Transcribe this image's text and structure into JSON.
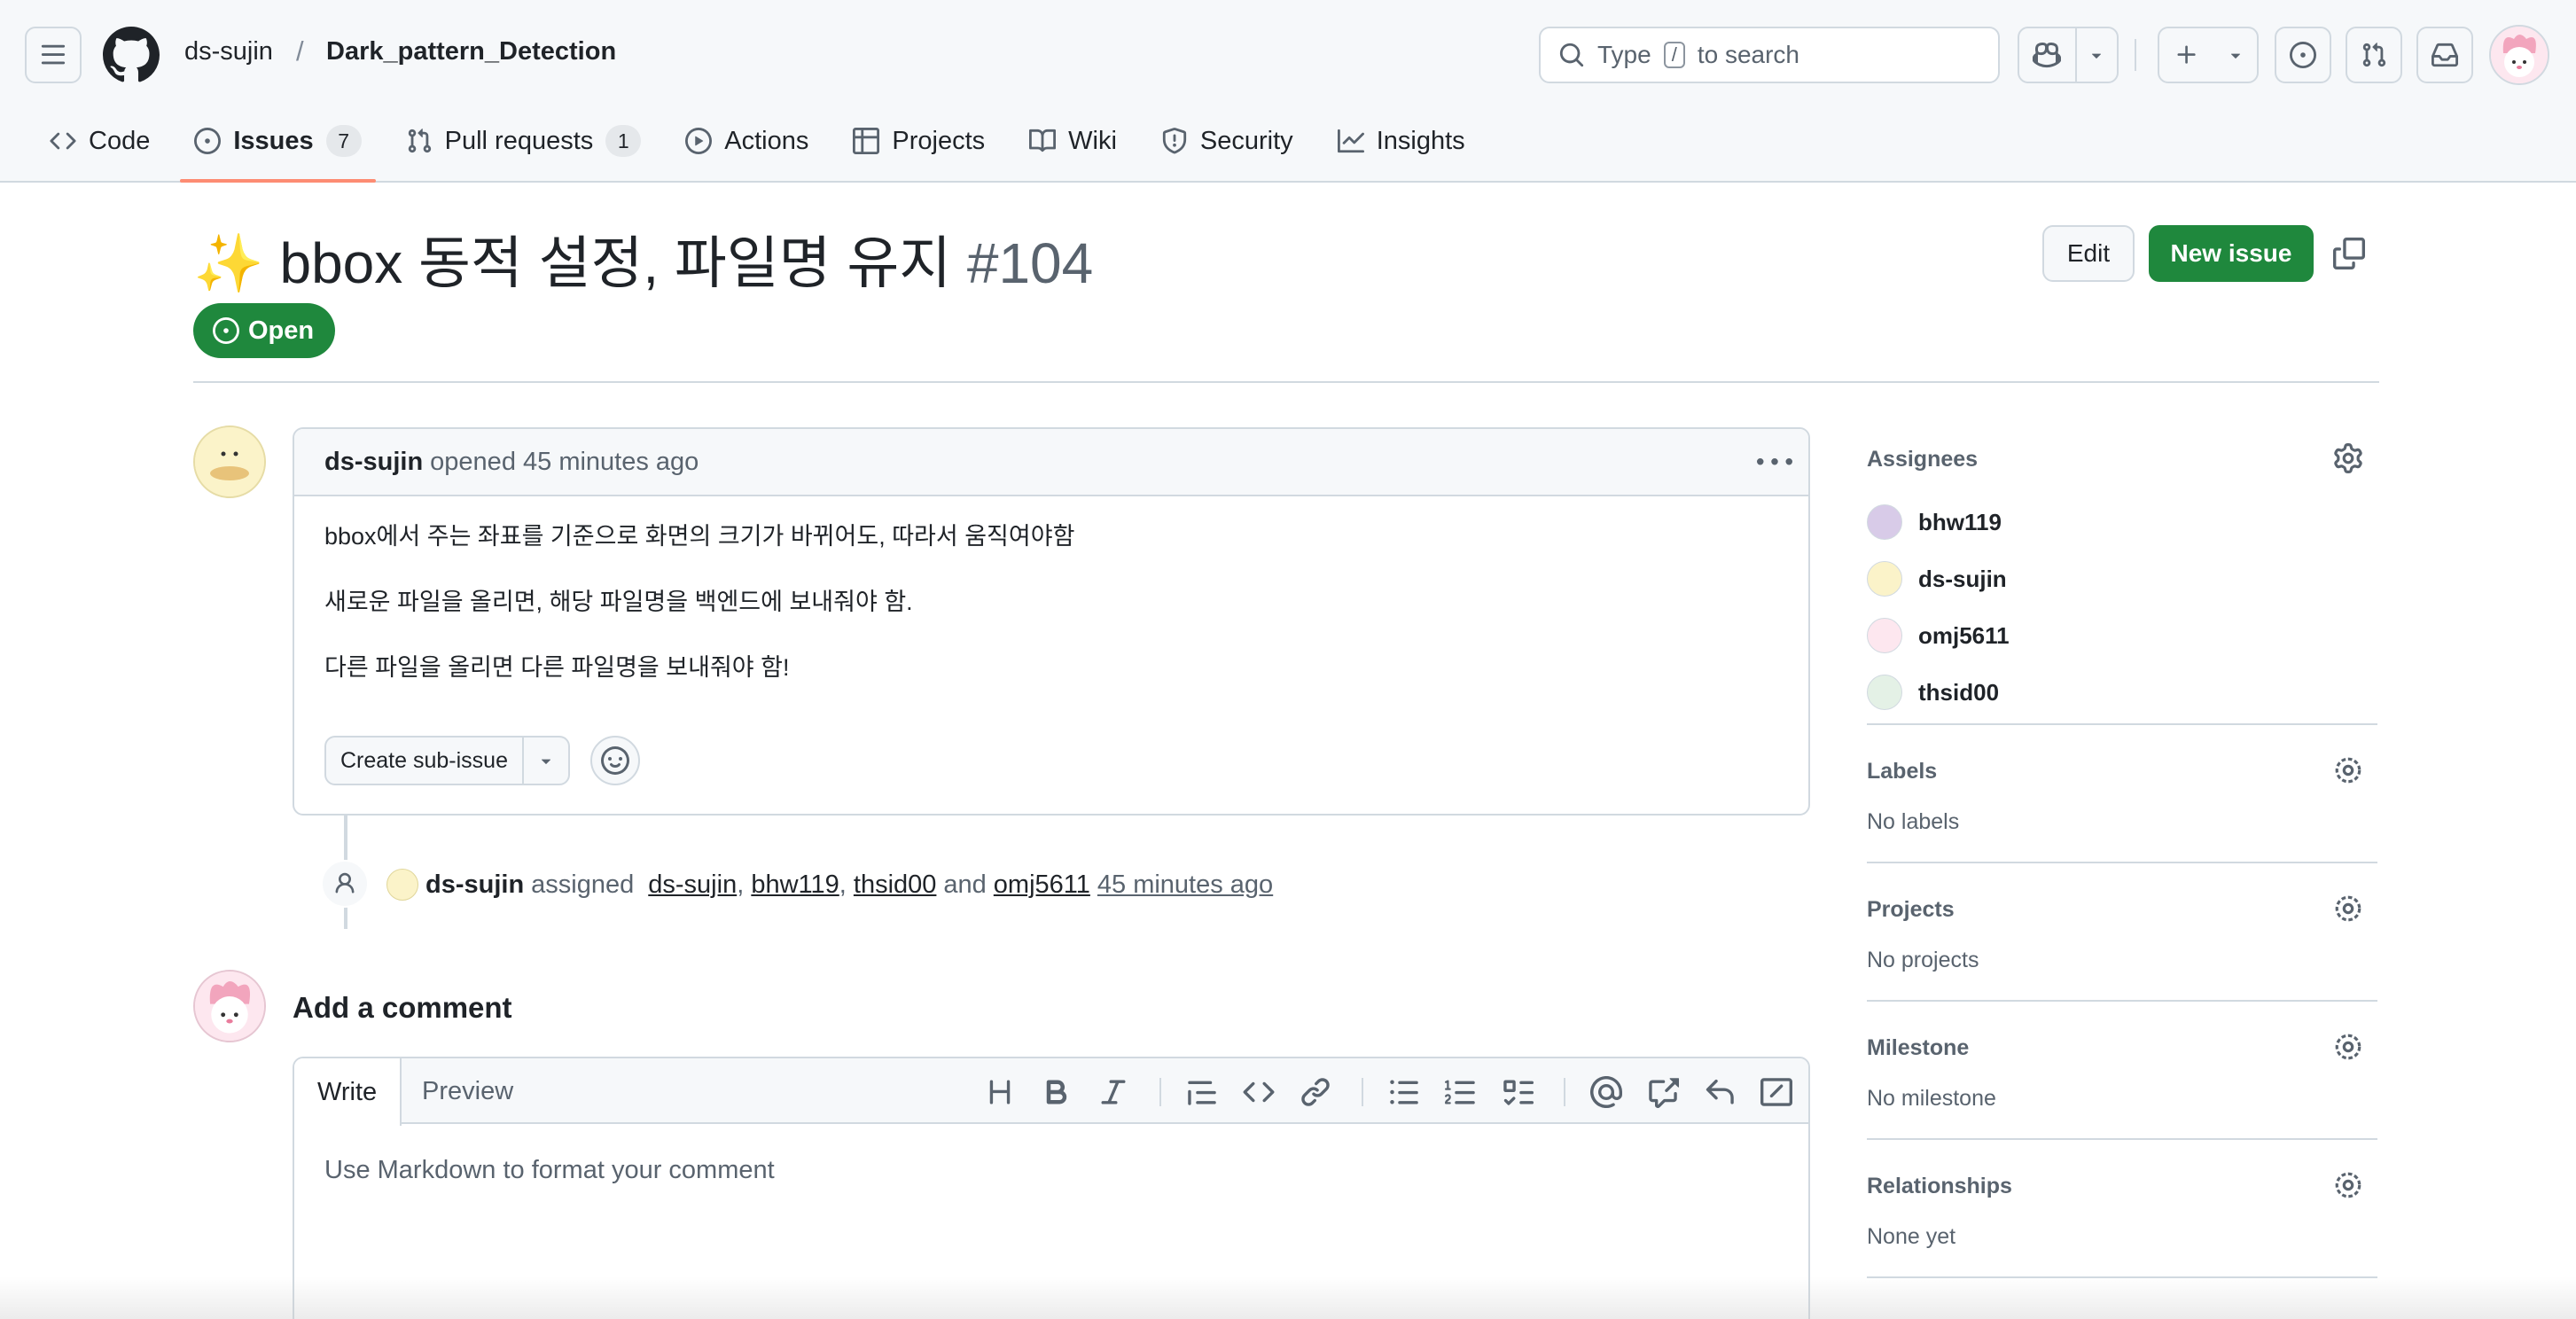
{
  "header": {
    "owner": "ds-sujin",
    "separator": "/",
    "repo": "Dark_pattern_Detection",
    "search": {
      "prefix": "Type",
      "key": "/",
      "suffix": "to search"
    }
  },
  "nav": {
    "tabs": [
      {
        "label": "Code",
        "icon": "code-icon"
      },
      {
        "label": "Issues",
        "count": "7",
        "icon": "issue-opened-icon",
        "active": true
      },
      {
        "label": "Pull requests",
        "count": "1",
        "icon": "git-pull-request-icon"
      },
      {
        "label": "Actions",
        "icon": "play-icon"
      },
      {
        "label": "Projects",
        "icon": "table-icon"
      },
      {
        "label": "Wiki",
        "icon": "book-icon"
      },
      {
        "label": "Security",
        "icon": "shield-icon"
      },
      {
        "label": "Insights",
        "icon": "graph-icon"
      }
    ]
  },
  "issue": {
    "emoji": "✨",
    "title": "bbox 동적 설정, 파일명 유지",
    "number": "#104",
    "state": "Open",
    "edit_label": "Edit",
    "new_issue_label": "New issue"
  },
  "comment": {
    "author": "ds-sujin",
    "meta": "opened 45 minutes ago",
    "body": [
      "bbox에서 주는 좌표를 기준으로 화면의 크기가 바뀌어도, 따라서 움직여야함",
      "새로운 파일을 올리면, 해당 파일명을 백엔드에 보내줘야 함.",
      "다른 파일을 올리면 다른 파일명을 보내줘야 함!"
    ],
    "sub_issue_label": "Create sub-issue"
  },
  "timeline": {
    "actor": "ds-sujin",
    "verb": "assigned",
    "users": [
      "ds-sujin",
      "bhw119",
      "thsid00"
    ],
    "and_word": "and",
    "last_user": "omj5611",
    "time": "45 minutes ago"
  },
  "add_comment": {
    "title": "Add a comment",
    "tab_write": "Write",
    "tab_preview": "Preview",
    "placeholder": "Use Markdown to format your comment"
  },
  "sidebar": {
    "assignees": {
      "heading": "Assignees",
      "people": [
        "bhw119",
        "ds-sujin",
        "omj5611",
        "thsid00"
      ]
    },
    "labels": {
      "heading": "Labels",
      "value": "No labels"
    },
    "projects": {
      "heading": "Projects",
      "value": "No projects"
    },
    "milestone": {
      "heading": "Milestone",
      "value": "No milestone"
    },
    "relationships": {
      "heading": "Relationships",
      "value": "None yet"
    }
  },
  "colors": {
    "accent_green": "#1f883d",
    "tab_underline": "#fd8c73",
    "header_bg": "#f6f8fa",
    "border": "#d1d9e0"
  }
}
